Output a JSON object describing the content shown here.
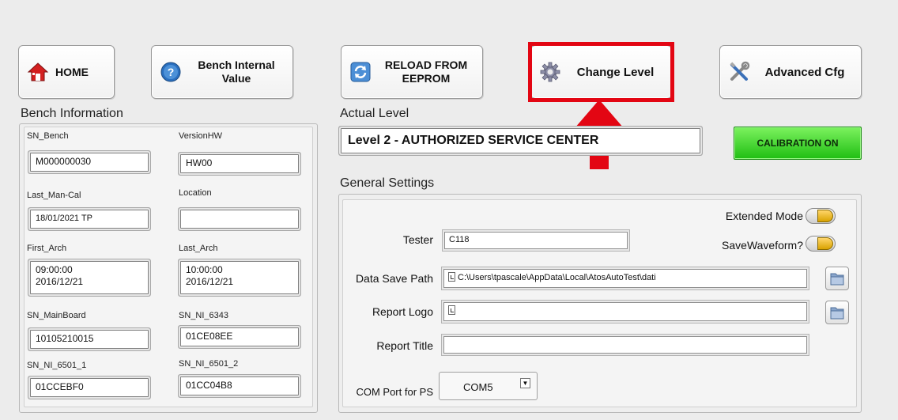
{
  "toolbar": {
    "home": "HOME",
    "bench_internal": "Bench Internal\nValue",
    "reload": "RELOAD FROM\nEEPROM",
    "change_level": "Change Level",
    "advanced": "Advanced Cfg"
  },
  "bench_info": {
    "title": "Bench Information",
    "fields": [
      {
        "label": "SN_Bench",
        "value": "M000000030"
      },
      {
        "label": "VersionHW",
        "value": "HW00"
      },
      {
        "label": "Last_Man-Cal",
        "value": "18/01/2021 TP"
      },
      {
        "label": "Location",
        "value": ""
      },
      {
        "label": "First_Arch",
        "value": "09:00:00\n2016/12/21"
      },
      {
        "label": "Last_Arch",
        "value": "10:00:00\n2016/12/21"
      },
      {
        "label": "SN_MainBoard",
        "value": "10105210015"
      },
      {
        "label": "SN_NI_6343",
        "value": "01CE08EE"
      },
      {
        "label": "SN_NI_6501_1",
        "value": "01CCEBF0"
      },
      {
        "label": "SN_NI_6501_2",
        "value": "01CC04B8"
      }
    ]
  },
  "actual_level": {
    "title": "Actual Level",
    "value": "Level 2 - AUTHORIZED SERVICE CENTER",
    "calibration": "CALIBRATION ON"
  },
  "general": {
    "title": "General Settings",
    "extended_mode": "Extended Mode",
    "save_waveform": "SaveWaveform?",
    "tester_label": "Tester",
    "tester_value": "C118",
    "data_save_path_label": "Data Save Path",
    "data_save_path_value": "C:\\Users\\tpascale\\AppData\\Local\\AtosAutoTest\\dati",
    "report_logo_label": "Report Logo",
    "report_logo_value": "",
    "report_title_label": "Report Title",
    "report_title_value": "",
    "com_port_label": "COM Port for PS",
    "com_port_value": "COM5"
  },
  "colors": {
    "highlight": "#e30613",
    "calibration_on": "#2fcf1c"
  }
}
